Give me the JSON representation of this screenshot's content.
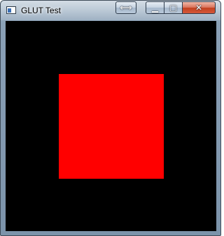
{
  "window": {
    "title": "GLUT Test",
    "app_icon": "window-icon",
    "frame_color": "#8aa0b6"
  },
  "titlebar_buttons": [
    {
      "name": "swap-arrows-icon",
      "glyph": "⟺"
    },
    {
      "name": "minimize-icon",
      "glyph": "▁"
    },
    {
      "name": "maximize-icon",
      "glyph": "▢"
    },
    {
      "name": "close-icon",
      "glyph": "✕",
      "color": "#c2411f"
    }
  ],
  "canvas": {
    "background_color": "#000000",
    "shape": {
      "type": "square",
      "color": "#ff0000"
    }
  }
}
